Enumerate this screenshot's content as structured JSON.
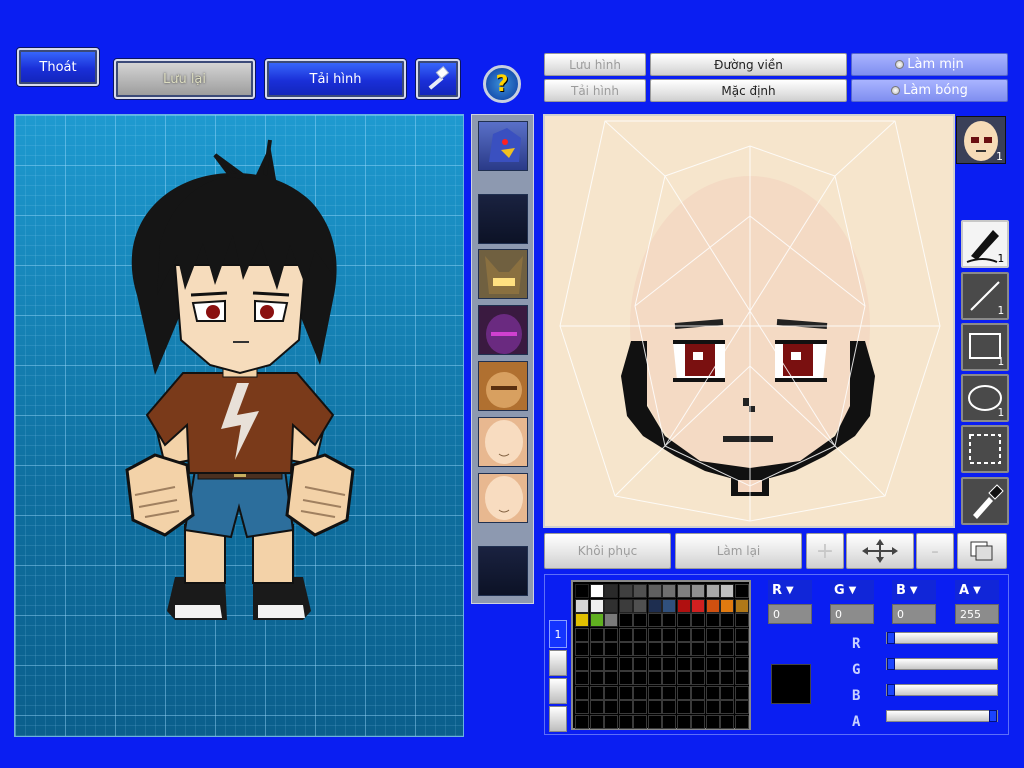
{
  "toolbar": {
    "exit_label": "Thoát",
    "save_label": "Lưu lại",
    "reload_label": "Tải hình"
  },
  "editor_toolbar": {
    "save_image_label": "Lưu hình",
    "load_image_label": "Tải hình",
    "outline_label": "Đường viền",
    "default_label": "Mặc định",
    "smooth_label": "Làm mịn",
    "shade_label": "Làm bóng"
  },
  "actions": {
    "restore_label": "Khôi phục",
    "redo_label": "Làm lại"
  },
  "tools": {
    "pen_count": "1",
    "line_count": "1",
    "rect_count": "1",
    "ellipse_count": "1",
    "face_preview_count": "1"
  },
  "color": {
    "r_label": "R",
    "g_label": "G",
    "b_label": "B",
    "a_label": "A",
    "r_value": "0",
    "g_value": "0",
    "b_value": "0",
    "a_value": "255",
    "r_fraction": 0,
    "g_fraction": 0,
    "b_fraction": 0,
    "a_fraction": 1,
    "current": "#000000",
    "palette_tab_label": "1",
    "palette_row1": [
      "#000000",
      "#ffffff",
      "#2a2a2a",
      "#404040",
      "#505050",
      "#606060",
      "#707070",
      "#808080",
      "#909090",
      "#a8a8a8",
      "#c0c0c0"
    ],
    "palette_row2": [
      "#d4d4d4",
      "#f0f0f0",
      "#303030",
      "#3c3c3c",
      "#505050",
      "#1e2e50",
      "#30507c",
      "#b01010",
      "#d02020",
      "#d05010",
      "#e07a10",
      "#b07818"
    ],
    "palette_row3": [
      "#e0c000",
      "#60b020",
      "#7a7a7a"
    ]
  },
  "colors": {
    "background": "#0a1ef2",
    "grid_bg": "#157fb4",
    "skin": "#f6e5cc"
  }
}
